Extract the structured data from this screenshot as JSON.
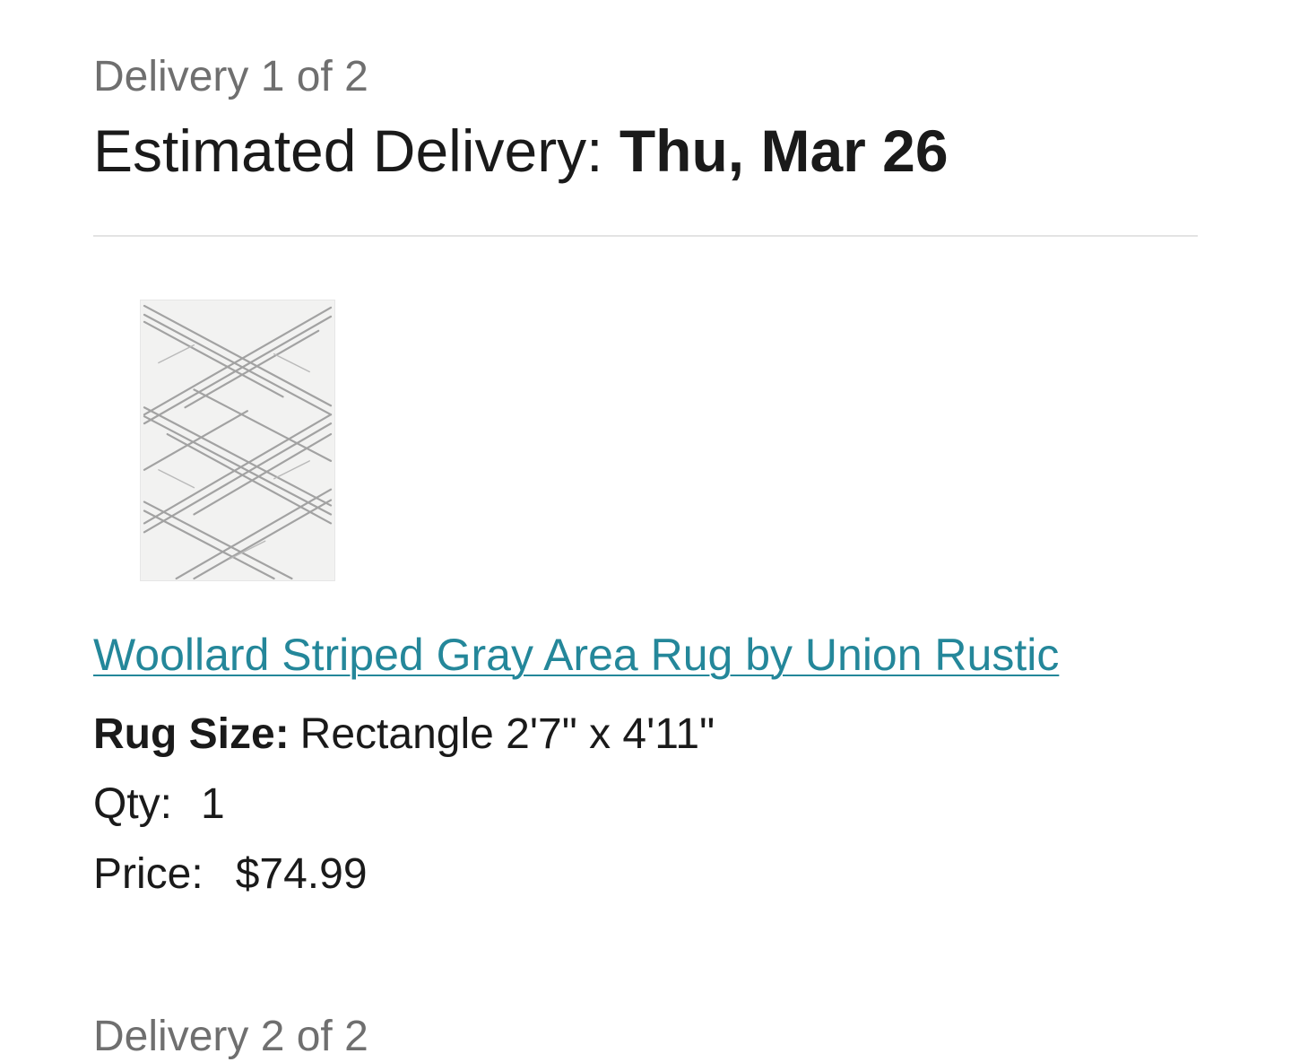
{
  "delivery": {
    "counter": "Delivery 1 of 2",
    "estimated_label": "Estimated Delivery:",
    "estimated_date": "Thu, Mar 26"
  },
  "item": {
    "image_icon": "rug-product-image",
    "title": "Woollard Striped Gray Area Rug by Union Rustic",
    "size_label": "Rug Size:",
    "size_value": "Rectangle 2'7\" x 4'11\"",
    "qty_label": "Qty:",
    "qty_value": "1",
    "price_label": "Price:",
    "price_value": "$74.99"
  },
  "next_delivery": {
    "counter": "Delivery 2 of 2"
  },
  "colors": {
    "link": "#24879a",
    "muted_text": "#6f6f6f",
    "divider": "#e3e3e3"
  }
}
